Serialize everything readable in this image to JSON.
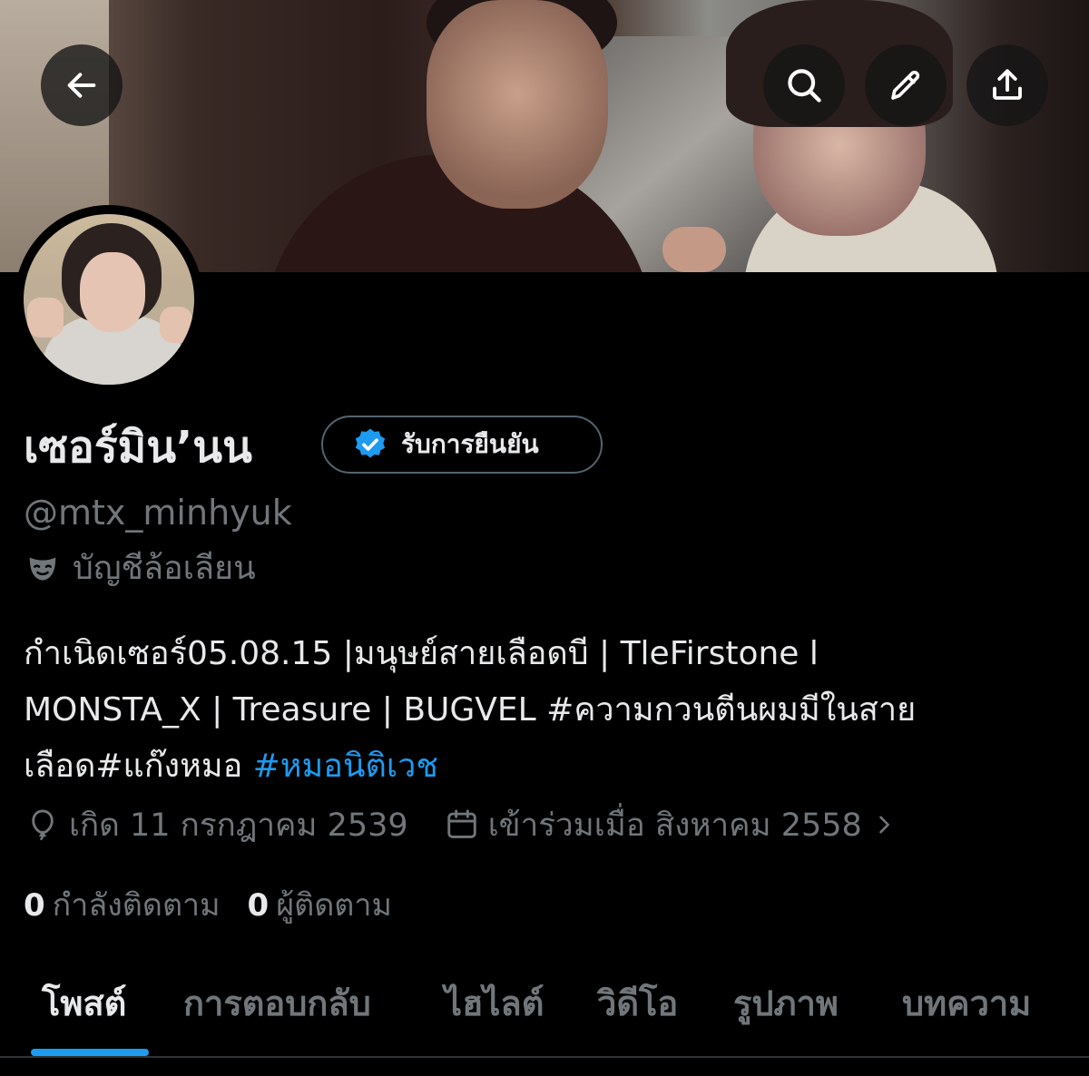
{
  "header": {
    "back_icon": "arrow-left-icon",
    "search_icon": "search-icon",
    "edit_icon": "pencil-icon",
    "share_icon": "share-upload-icon"
  },
  "profile": {
    "display_name": "เซอร์มิน’นน",
    "verify_button_label": "รับการยืนยัน",
    "handle": "@mtx_minhyuk",
    "parody_label": "บัญชีล้อเลียน",
    "bio": {
      "line1": "กำเนิดเซอร์05.08.15 |มนุษย์สายเลือดบี | TleFirstone l",
      "line2": "MONSTA_X | Treasure | BUGVEL #ความกวนตีนผมมีในสาย",
      "line3_text": "เลือด#แก๊งหมอ ",
      "line3_hashtag": "#หมอนิติเวช"
    },
    "birth": "เกิด 11 กรกฎาคม 2539",
    "joined": "เข้าร่วมเมื่อ สิงหาคม 2558",
    "following_count": "0",
    "following_label": "กำลังติดตาม",
    "followers_count": "0",
    "followers_label": "ผู้ติดตาม"
  },
  "tabs": [
    {
      "label": "โพสต์",
      "active": true
    },
    {
      "label": "การตอบกลับ",
      "active": false
    },
    {
      "label": "ไฮไลต์",
      "active": false
    },
    {
      "label": "วิดีโอ",
      "active": false
    },
    {
      "label": "รูปภาพ",
      "active": false
    },
    {
      "label": "บทความ",
      "active": false
    }
  ],
  "colors": {
    "background": "#000000",
    "primary_text": "#e7e9ea",
    "secondary_text": "#71767b",
    "accent": "#1d9bf0"
  }
}
